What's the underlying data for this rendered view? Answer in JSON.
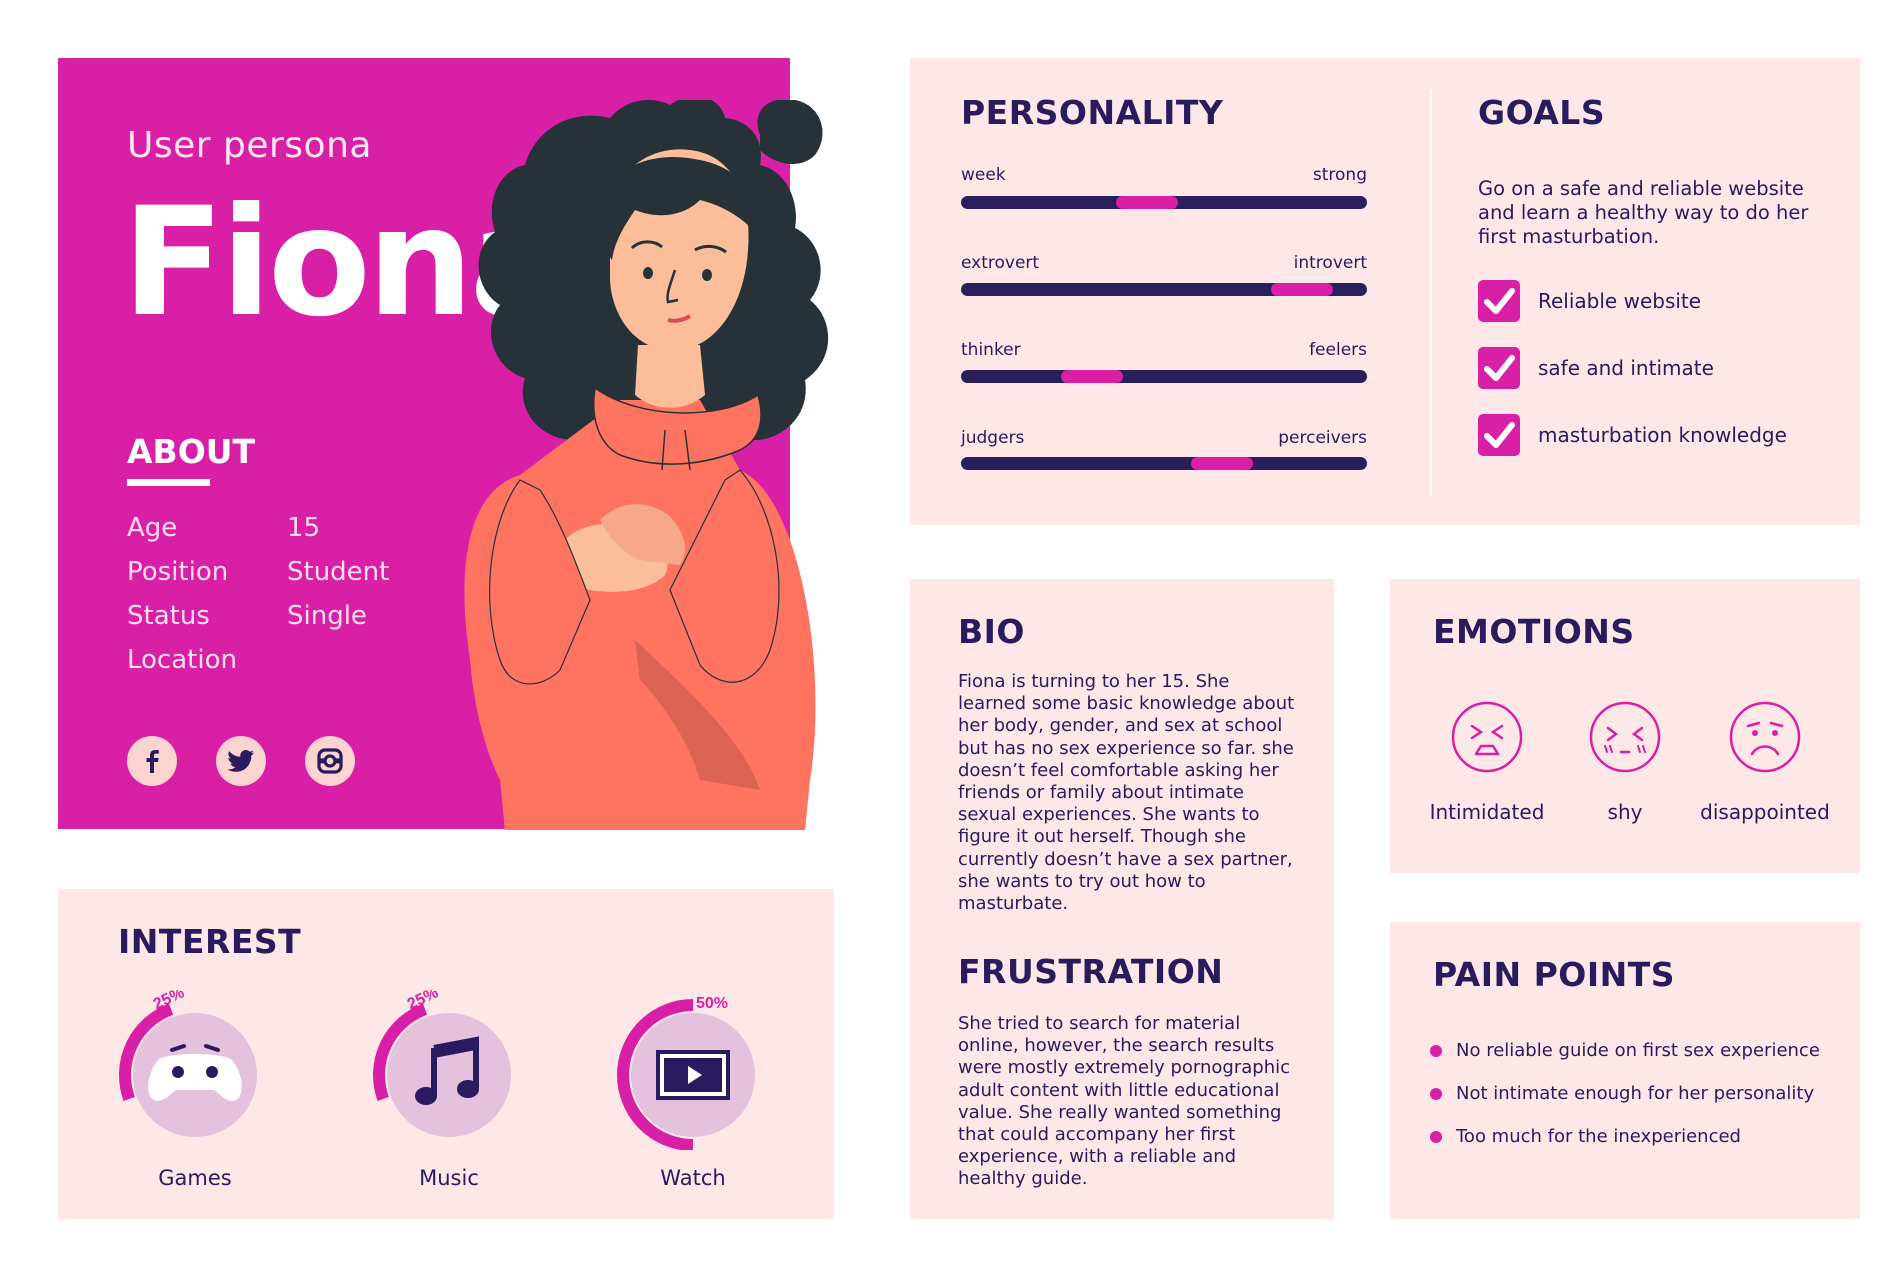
{
  "header": {
    "subtitle": "User persona",
    "name": "Fiona"
  },
  "about": {
    "title": "ABOUT",
    "rows": [
      {
        "key": "Age",
        "value": "15"
      },
      {
        "key": "Position",
        "value": "Student"
      },
      {
        "key": "Status",
        "value": "Single"
      },
      {
        "key": "Location",
        "value": ""
      }
    ]
  },
  "social": [
    "facebook-icon",
    "twitter-icon",
    "instagram-icon"
  ],
  "personality": {
    "title": "PERSONALITY",
    "traits": [
      {
        "left": "week",
        "right": "strong",
        "level": 0.45
      },
      {
        "left": "extrovert",
        "right": "introvert",
        "level": 0.91
      },
      {
        "left": "thinker",
        "right": "feelers",
        "level": 0.4
      },
      {
        "left": "judgers",
        "right": "perceivers",
        "level": 0.71
      }
    ]
  },
  "goals": {
    "title": "GOALS",
    "text": "Go on a safe and reliable website and learn a healthy way to do her first masturbation.",
    "items": [
      "Reliable website",
      "safe and intimate",
      "masturbation knowledge"
    ]
  },
  "bio": {
    "title": "BIO",
    "text": "Fiona is turning to her 15. She learned some basic knowledge about her body, gender, and sex at school but has no sex experience so far. she doesn’t feel comfortable asking her friends or family about intimate sexual experiences. She wants to figure it out herself. Though she currently doesn’t have a sex partner, she wants to try out how to masturbate."
  },
  "frustration": {
    "title": "FRUSTRATION",
    "text": "She tried to search for material online, however, the search results were mostly extremely pornographic adult content with little educational value. She really wanted something that could accompany her first experience, with a reliable and healthy guide."
  },
  "emotions": {
    "title": "EMOTIONS",
    "items": [
      {
        "label": "Intimidated",
        "icon": "intimidated-face-icon"
      },
      {
        "label": "shy",
        "icon": "shy-face-icon"
      },
      {
        "label": "disappointed",
        "icon": "disappointed-face-icon"
      }
    ]
  },
  "pain_points": {
    "title": "PAIN POINTS",
    "items": [
      "No reliable guide on first sex experience",
      "Not intimate enough for her personality",
      "Too much for the inexperienced"
    ]
  },
  "interest": {
    "title": "INTEREST",
    "items": [
      {
        "label": "Games",
        "percent_label": "25%",
        "percent": 25,
        "icon": "gamepad-icon"
      },
      {
        "label": "Music",
        "percent_label": "25%",
        "percent": 25,
        "icon": "music-note-icon"
      },
      {
        "label": "Watch",
        "percent_label": "50%",
        "percent": 50,
        "icon": "video-play-icon"
      }
    ]
  },
  "colors": {
    "accent": "#d81fa6",
    "navy": "#2a1a5e",
    "panel": "#fde8e7",
    "circle": "#e4c1dc",
    "hoodie": "#fe7460",
    "hair": "#263238",
    "skin": "#fbbd9a"
  }
}
